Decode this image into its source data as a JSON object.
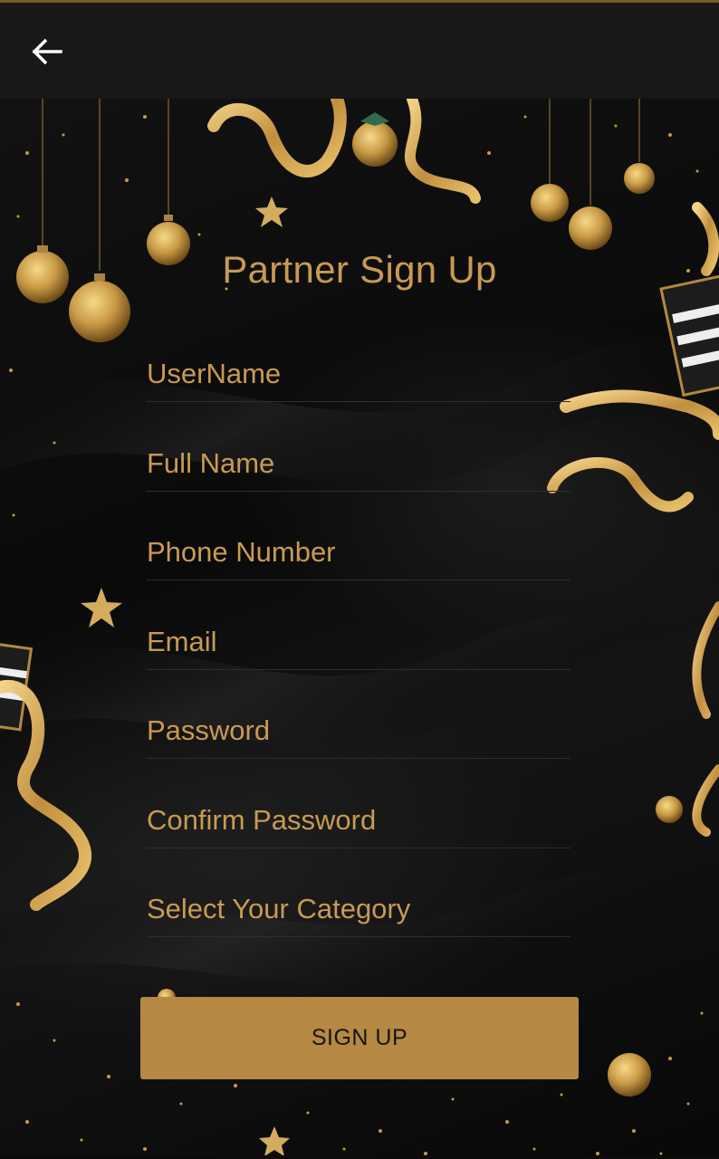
{
  "app_bar": {
    "back_icon": "arrow-left-icon"
  },
  "page": {
    "title": "Partner Sign Up"
  },
  "form": {
    "fields": [
      {
        "name": "username",
        "placeholder": "UserName",
        "value": ""
      },
      {
        "name": "full_name",
        "placeholder": "Full Name",
        "value": ""
      },
      {
        "name": "phone_number",
        "placeholder": "Phone Number",
        "value": ""
      },
      {
        "name": "email",
        "placeholder": "Email",
        "value": ""
      },
      {
        "name": "password",
        "placeholder": "Password",
        "value": ""
      },
      {
        "name": "confirm_password",
        "placeholder": "Confirm Password",
        "value": ""
      },
      {
        "name": "category",
        "placeholder": "Select Your Category",
        "value": ""
      }
    ],
    "submit_label": "SIGN UP"
  },
  "colors": {
    "accent": "#c99a52",
    "button": "#b58843",
    "appbar": "#181818",
    "background": "#0b0b0b"
  }
}
